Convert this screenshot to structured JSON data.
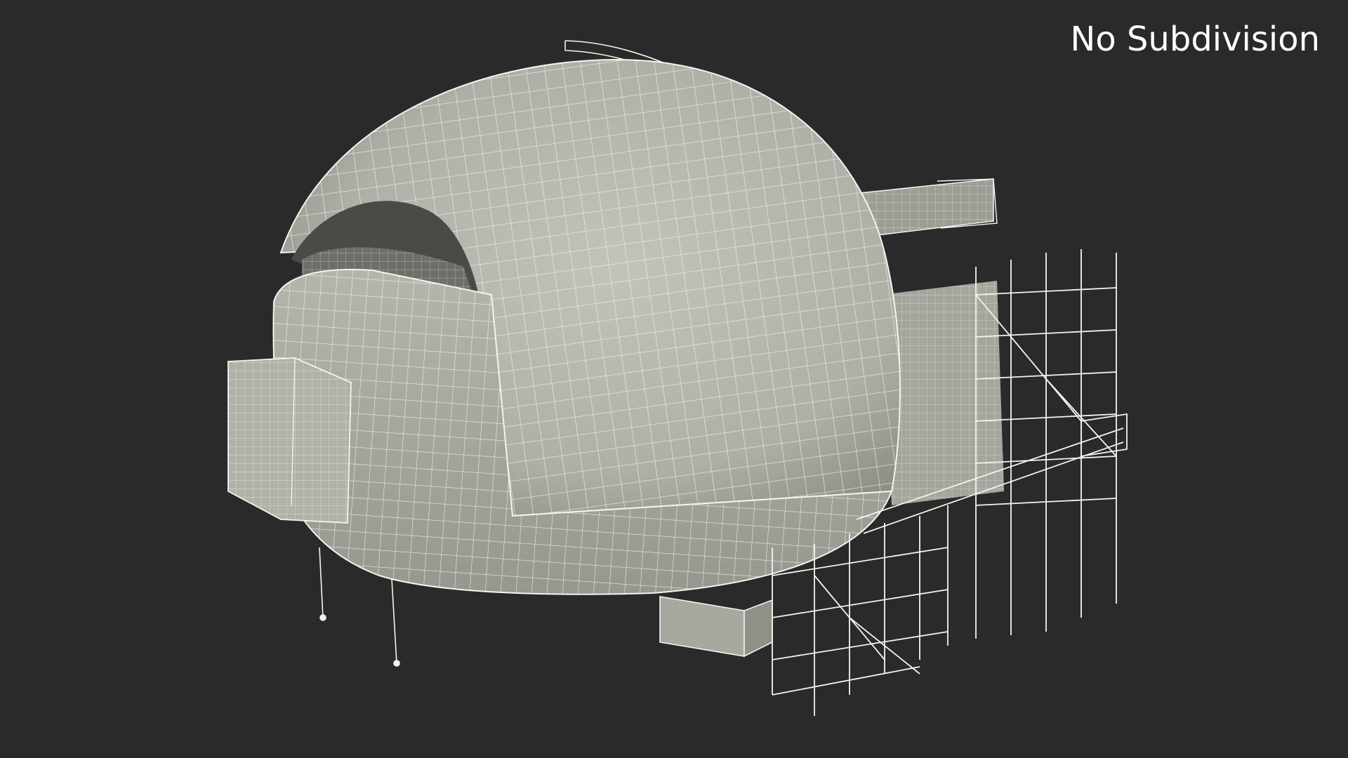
{
  "overlay": {
    "label": "No Subdivision"
  },
  "colors": {
    "background": "#2a2a2a",
    "surface": "#b7b8ae",
    "surface_shadow": "#8c8d85",
    "wire": "#f4f4ee",
    "label": "#ffffff"
  }
}
